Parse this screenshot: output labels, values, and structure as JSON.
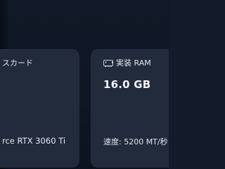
{
  "cards": {
    "gpu": {
      "title": "スカード",
      "name": "rce RTX 3060 Ti"
    },
    "ram": {
      "title": "実装 RAM",
      "icon": "ram-icon",
      "value": "16.0 GB",
      "speed": "速度: 5200 MT/秒"
    }
  },
  "colors": {
    "background": "#131a29",
    "card": "#222b3b",
    "text": "#e9edf3"
  }
}
